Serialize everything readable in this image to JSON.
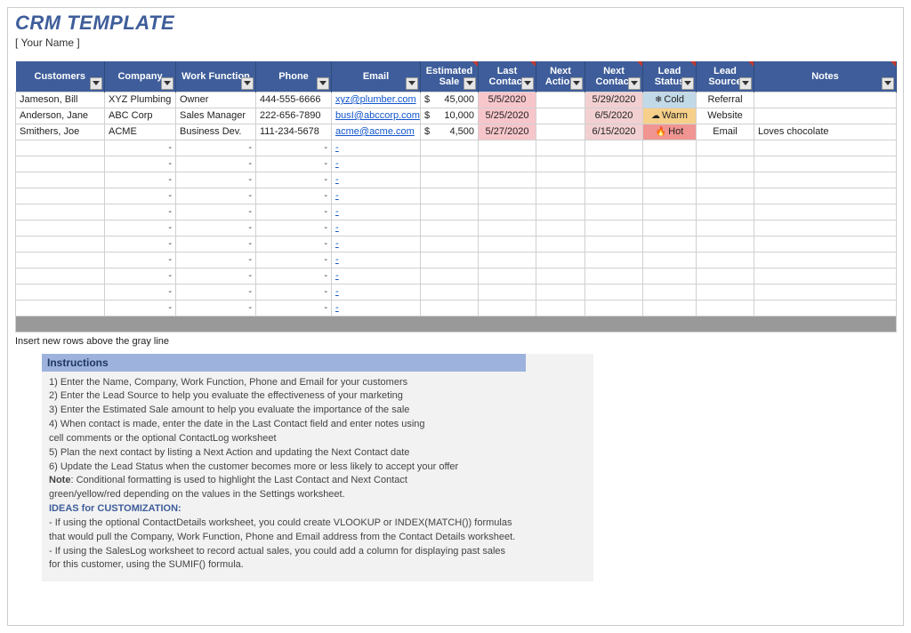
{
  "header": {
    "title": "CRM TEMPLATE",
    "subtitle": "[ Your Name ]"
  },
  "columns": {
    "customers": "Customers",
    "company": "Company",
    "function": "Work Function",
    "phone": "Phone",
    "email": "Email",
    "sale": "Estimated Sale",
    "last": "Last Contact",
    "naction": "Next Action",
    "ncontact": "Next Contact",
    "status": "Lead Status",
    "source": "Lead Source",
    "notes": "Notes"
  },
  "rows": [
    {
      "customer": "Jameson, Bill",
      "company": "XYZ Plumbing",
      "function": "Owner",
      "phone": "444-555-6666",
      "email": "xyz@plumber.com",
      "sale": "45,000",
      "last": "5/5/2020",
      "ncontact": "5/29/2020",
      "status": "Cold",
      "status_icon": "❄",
      "source": "Referral",
      "notes": ""
    },
    {
      "customer": "Anderson, Jane",
      "company": "ABC Corp",
      "function": "Sales Manager",
      "phone": "222-656-7890",
      "email": "busI@abccorp.com",
      "sale": "10,000",
      "last": "5/25/2020",
      "ncontact": "6/5/2020",
      "status": "Warm",
      "status_icon": "☁",
      "source": "Website",
      "notes": ""
    },
    {
      "customer": "Smithers, Joe",
      "company": "ACME",
      "function": "Business Dev.",
      "phone": "111-234-5678",
      "email": "acme@acme.com",
      "sale": "4,500",
      "last": "5/27/2020",
      "ncontact": "6/15/2020",
      "status": "Hot",
      "status_icon": "🔥",
      "source": "Email",
      "notes": "Loves chocolate"
    }
  ],
  "empty_dash": "-",
  "insert_note": "Insert new rows above the gray line",
  "instructions": {
    "title": "Instructions",
    "lines": [
      "1) Enter the Name, Company, Work Function, Phone and Email for your customers",
      "2) Enter the Lead Source to help you evaluate the effectiveness of your marketing",
      "3) Enter the Estimated Sale amount to help you evaluate the importance of the sale",
      "4) When contact is made, enter the date in the Last Contact field and enter notes using",
      "cell comments or the optional ContactLog worksheet",
      "5) Plan the next contact by listing a Next Action and updating the Next Contact date",
      "6) Update the Lead Status when the customer becomes more or less likely to accept your offer"
    ],
    "note_label": "Note",
    "note_text": ": Conditional formatting is used to highlight the Last Contact and Next Contact",
    "note_text2": "green/yellow/red depending on the values in the Settings worksheet.",
    "ideas_title": "IDEAS for CUSTOMIZATION:",
    "ideas": [
      "- If using the optional ContactDetails worksheet, you could create VLOOKUP or INDEX(MATCH()) formulas",
      "that would pull the Company, Work Function, Phone and Email address from the Contact Details worksheet.",
      "- If using the SalesLog worksheet to record actual sales, you could add a column for displaying past sales",
      "for this customer, using the SUMIF() formula."
    ]
  }
}
